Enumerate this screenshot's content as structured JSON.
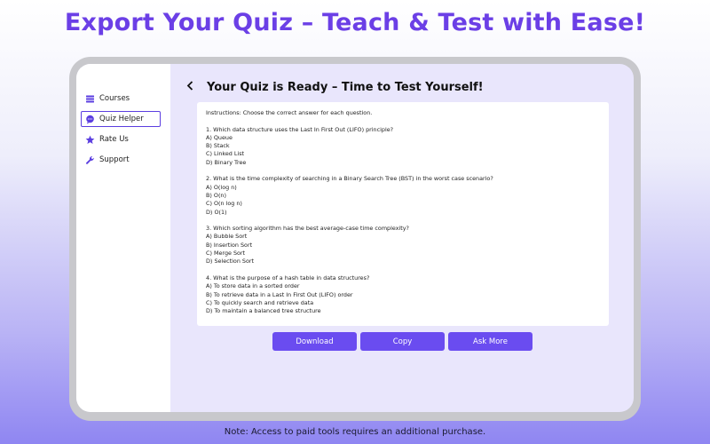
{
  "headline": "Export Your Quiz – Teach & Test with Ease!",
  "sidebar": {
    "items": [
      {
        "label": "Courses",
        "icon": "courses-icon"
      },
      {
        "label": "Quiz Helper",
        "icon": "chat-icon",
        "active": true
      },
      {
        "label": "Rate Us",
        "icon": "star-icon"
      },
      {
        "label": "Support",
        "icon": "wrench-icon"
      }
    ]
  },
  "main": {
    "back_icon": "‹",
    "title": "Your Quiz is Ready – Time to Test Yourself!",
    "quiz_text": "Instructions: Choose the correct answer for each question.\n\n1. Which data structure uses the Last In First Out (LIFO) principle?\nA) Queue\nB) Stack\nC) Linked List\nD) Binary Tree\n\n2. What is the time complexity of searching in a Binary Search Tree (BST) in the worst case scenario?\nA) O(log n)\nB) O(n)\nC) O(n log n)\nD) O(1)\n\n3. Which sorting algorithm has the best average-case time complexity?\nA) Bubble Sort\nB) Insertion Sort\nC) Merge Sort\nD) Selection Sort\n\n4. What is the purpose of a hash table in data structures?\nA) To store data in a sorted order\nB) To retrieve data in a Last In First Out (LIFO) order\nC) To quickly search and retrieve data\nD) To maintain a balanced tree structure"
  },
  "actions": {
    "download_label": "Download",
    "copy_label": "Copy",
    "ask_more_label": "Ask More"
  },
  "footer_note": "Note: Access to paid tools requires an additional purchase.",
  "colors": {
    "accent": "#6a4cf0",
    "headline": "#6b3fe6",
    "panel_bg": "#e9e6fc"
  }
}
